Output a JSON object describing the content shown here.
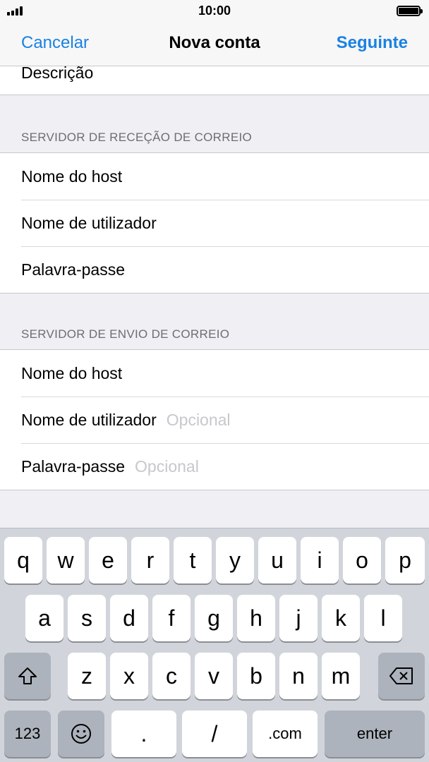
{
  "status_bar": {
    "time": "10:00"
  },
  "nav": {
    "cancel": "Cancelar",
    "title": "Nova conta",
    "next": "Seguinte"
  },
  "form": {
    "description_label": "Descrição",
    "incoming": {
      "header": "SERVIDOR DE RECEÇÃO DE CORREIO",
      "host": "Nome do host",
      "username": "Nome de utilizador",
      "password": "Palavra-passe"
    },
    "outgoing": {
      "header": "SERVIDOR DE ENVIO DE CORREIO",
      "host": "Nome do host",
      "username": "Nome de utilizador",
      "username_placeholder": "Opcional",
      "password": "Palavra-passe",
      "password_placeholder": "Opcional"
    }
  },
  "keyboard": {
    "row1": [
      "q",
      "w",
      "e",
      "r",
      "t",
      "y",
      "u",
      "i",
      "o",
      "p"
    ],
    "row2": [
      "a",
      "s",
      "d",
      "f",
      "g",
      "h",
      "j",
      "k",
      "l"
    ],
    "row3": [
      "z",
      "x",
      "c",
      "v",
      "b",
      "n",
      "m"
    ],
    "numbers": "123",
    "period": ".",
    "slash": "/",
    "dotcom": ".com",
    "enter": "enter",
    "icons": {
      "shift": "shift-icon",
      "delete": "delete-icon",
      "emoji": "emoji-icon"
    }
  }
}
